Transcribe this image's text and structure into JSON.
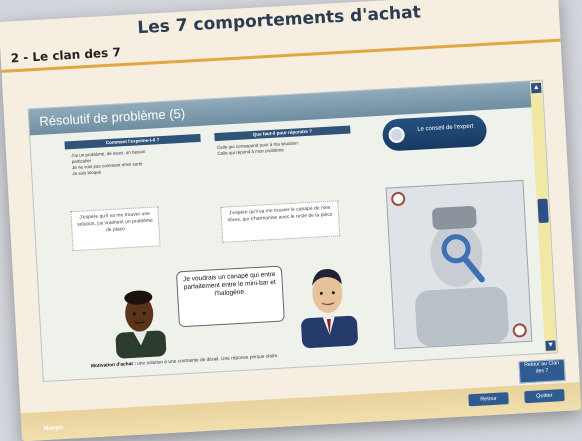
{
  "app": {
    "title": "Les 7 comportements d'achat"
  },
  "section": {
    "title": "2 - Le clan des 7"
  },
  "panel": {
    "title": "Résolutif de problème (5)",
    "table": {
      "col1_header": "Comment l'exprime-t-il ?",
      "col1_lines": [
        "J'ai un problème, de souci, un besoin",
        "particulier",
        "Je ne vois pas comment m'en sortir",
        "Je suis bloqué"
      ],
      "col2_header": "Que faut-il pour répondre ?",
      "col2_lines": [
        "Celle qui correspond pour à ma situation",
        "Celle qui répond à mon problème"
      ]
    },
    "expert_button": "Le conseil de l'expert",
    "thought_left": "J'espère qu'il va me trouver une solution, j'ai vraiment un problème de place",
    "thought_right": "J'espère qu'il va me trouver le canapé de mes rêves, qui s'harmonise avec le reste de la pièce",
    "speech": "Je voudrais un canapé qui entre parfaitement entre le mini-bar et l'halogène.",
    "caption_label": "Motivation d'achat :",
    "caption_text": "une solution à une contrainte de dérail. Une réponse perçue claire."
  },
  "buttons": {
    "return": "Retour au Clan des 7",
    "prev": "Retour",
    "next": "Quitter"
  },
  "footer": {
    "logo": "Mango"
  },
  "colors": {
    "accent": "#2f5b91",
    "header": "#6f8ea2"
  }
}
